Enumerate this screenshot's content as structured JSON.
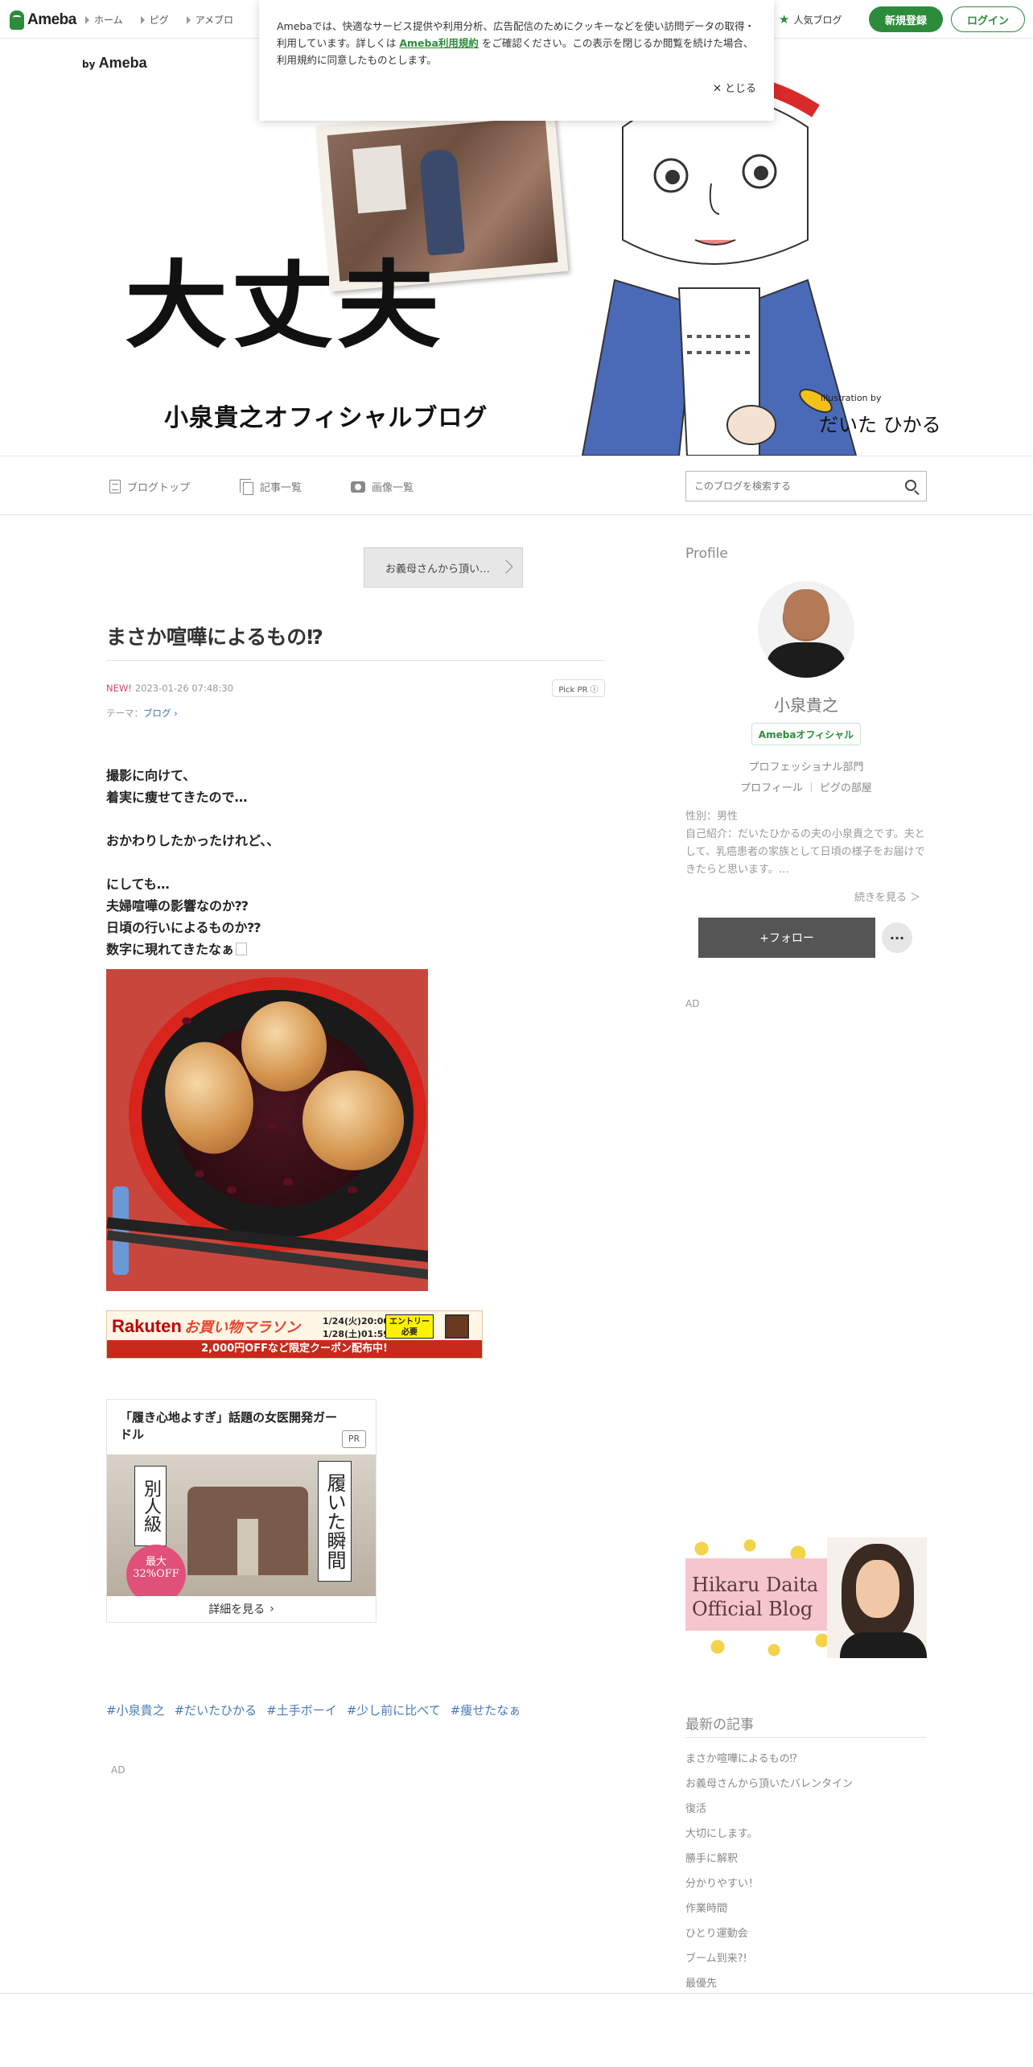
{
  "global_header": {
    "logo": "Ameba",
    "nav": [
      "ホーム",
      "ピグ",
      "アメブロ"
    ],
    "popular": "人気ブログ",
    "register": "新規登録",
    "login": "ログイン"
  },
  "cookie_notice": {
    "text_before": "Amebaでは、快適なサービス提供や利用分析、広告配信のためにクッキーなどを使い訪問データの取得・利用しています。詳しくは ",
    "link": "Ameba利用規約",
    "text_after": " をご確認ください。この表示を閉じるか閲覧を続けた場合、利用規約に同意したものとします。",
    "close": "とじる"
  },
  "banner": {
    "by_prefix": "by",
    "by_brand": "Ameba",
    "title": "大丈夫",
    "subtitle": "小泉貴之オフィシャルブログ",
    "illus_credit": "illustration by",
    "illus_sign": "だいた ひかる"
  },
  "blog_nav": {
    "top": "ブログトップ",
    "entries": "記事一覧",
    "images": "画像一覧",
    "search_placeholder": "このブログを検索する"
  },
  "entry": {
    "prev_link": "お義母さんから頂い…",
    "title": "まさか喧嘩によるもの⁉︎",
    "new_label": "NEW!",
    "date": "2023-01-26 07:48:30",
    "pick_pr": "Pick PR ⓘ",
    "theme_label": "テーマ：",
    "theme": "ブログ",
    "body": [
      "撮影に向けて、",
      "着実に痩せてきたので…",
      "",
      "おかわりしたかったけれど、、",
      "",
      "にしても…",
      "夫婦喧嘩の影響なのか⁇",
      "日頃の行いによるものか⁇",
      "数字に現れてきたなぁ"
    ],
    "hashtags": [
      "#小泉貴之",
      "#だいたひかる",
      "#土手ボーイ",
      "#少し前に比べて",
      "#痩せたなぁ"
    ],
    "ad_label": "AD"
  },
  "rakuten_ad": {
    "logo": "Rakuten",
    "title": "お買い物マラソン",
    "date1": "1/24(火)20:00",
    "date2": "1/28(土)01:59",
    "entry": "エントリー必要",
    "footer": "2,000円OFFなど限定クーポン配布中!"
  },
  "pr_ad": {
    "title": "「履き心地よすぎ」話題の女医開発ガードル",
    "badge": "PR",
    "left_text": "別人級",
    "right_text": "履いた瞬間",
    "off_text": "最大32%OFF",
    "more": "詳細を見る"
  },
  "sidebar": {
    "profile_head": "Profile",
    "name": "小泉貴之",
    "official": "Amebaオフィシャル",
    "dept": "プロフェッショナル部門",
    "link_profile": "プロフィール",
    "link_pig": "ピグの部屋",
    "bio_gender": "性別：男性",
    "bio_intro": "自己紹介：だいたひかるの夫の小泉貴之です。夫として、乳癌患者の家族として日頃の様子をお届けできたらと思います。…",
    "read_more": "続きを見る ＞",
    "follow": "+フォロー",
    "more": "···",
    "ad_label": "AD",
    "banner_line1": "Hikaru Daita",
    "banner_line2": "Official Blog",
    "recent_head": "最新の記事",
    "recent": [
      "まさか喧嘩によるもの⁉︎",
      "お義母さんから頂いたバレンタイン",
      "復活",
      "大切にします。",
      "勝手に解釈",
      "分かりやすい！",
      "作業時間",
      "ひとり運動会",
      "ブーム到来?!",
      "最優先"
    ]
  },
  "colors": {
    "brand_green": "#2d8c3c",
    "new_pink": "#d9447a",
    "link_blue": "#4a7ab8"
  }
}
